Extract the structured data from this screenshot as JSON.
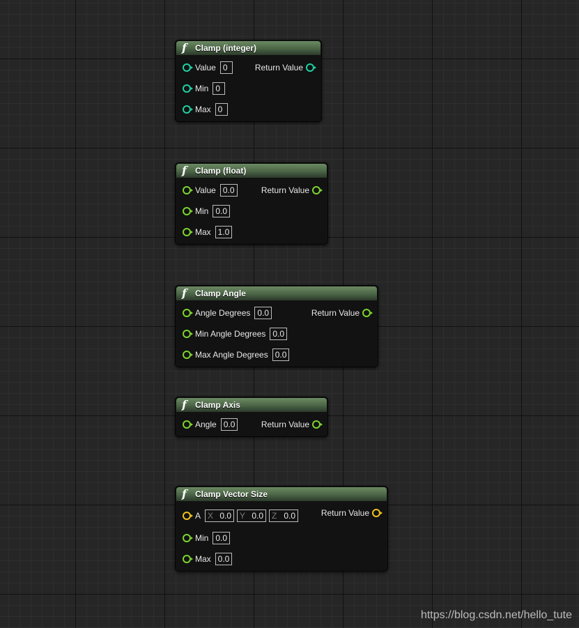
{
  "nodes": {
    "clamp_int": {
      "title": "Clamp (integer)",
      "return_label": "Return Value",
      "inputs": [
        {
          "label": "Value",
          "value": "0"
        },
        {
          "label": "Min",
          "value": "0"
        },
        {
          "label": "Max",
          "value": "0"
        }
      ]
    },
    "clamp_float": {
      "title": "Clamp (float)",
      "return_label": "Return Value",
      "inputs": [
        {
          "label": "Value",
          "value": "0.0"
        },
        {
          "label": "Min",
          "value": "0.0"
        },
        {
          "label": "Max",
          "value": "1.0"
        }
      ]
    },
    "clamp_angle": {
      "title": "Clamp Angle",
      "return_label": "Return Value",
      "inputs": [
        {
          "label": "Angle Degrees",
          "value": "0.0"
        },
        {
          "label": "Min Angle Degrees",
          "value": "0.0"
        },
        {
          "label": "Max Angle Degrees",
          "value": "0.0"
        }
      ]
    },
    "clamp_axis": {
      "title": "Clamp Axis",
      "return_label": "Return Value",
      "inputs": [
        {
          "label": "Angle",
          "value": "0.0"
        }
      ]
    },
    "clamp_vector_size": {
      "title": "Clamp Vector Size",
      "return_label": "Return Value",
      "vector_input": {
        "label": "A",
        "components": [
          {
            "axis": "X",
            "value": "0.0"
          },
          {
            "axis": "Y",
            "value": "0.0"
          },
          {
            "axis": "Z",
            "value": "0.0"
          }
        ]
      },
      "inputs": [
        {
          "label": "Min",
          "value": "0.0"
        },
        {
          "label": "Max",
          "value": "0.0"
        }
      ]
    }
  },
  "watermark": "https://blog.csdn.net/hello_tute",
  "colors": {
    "float_pin": "#7dd530",
    "int_pin": "#1fd1a6",
    "vector_pin": "#f2c21b",
    "header_green": "#4a6445"
  },
  "icons": {
    "node_icon": "function-icon"
  }
}
